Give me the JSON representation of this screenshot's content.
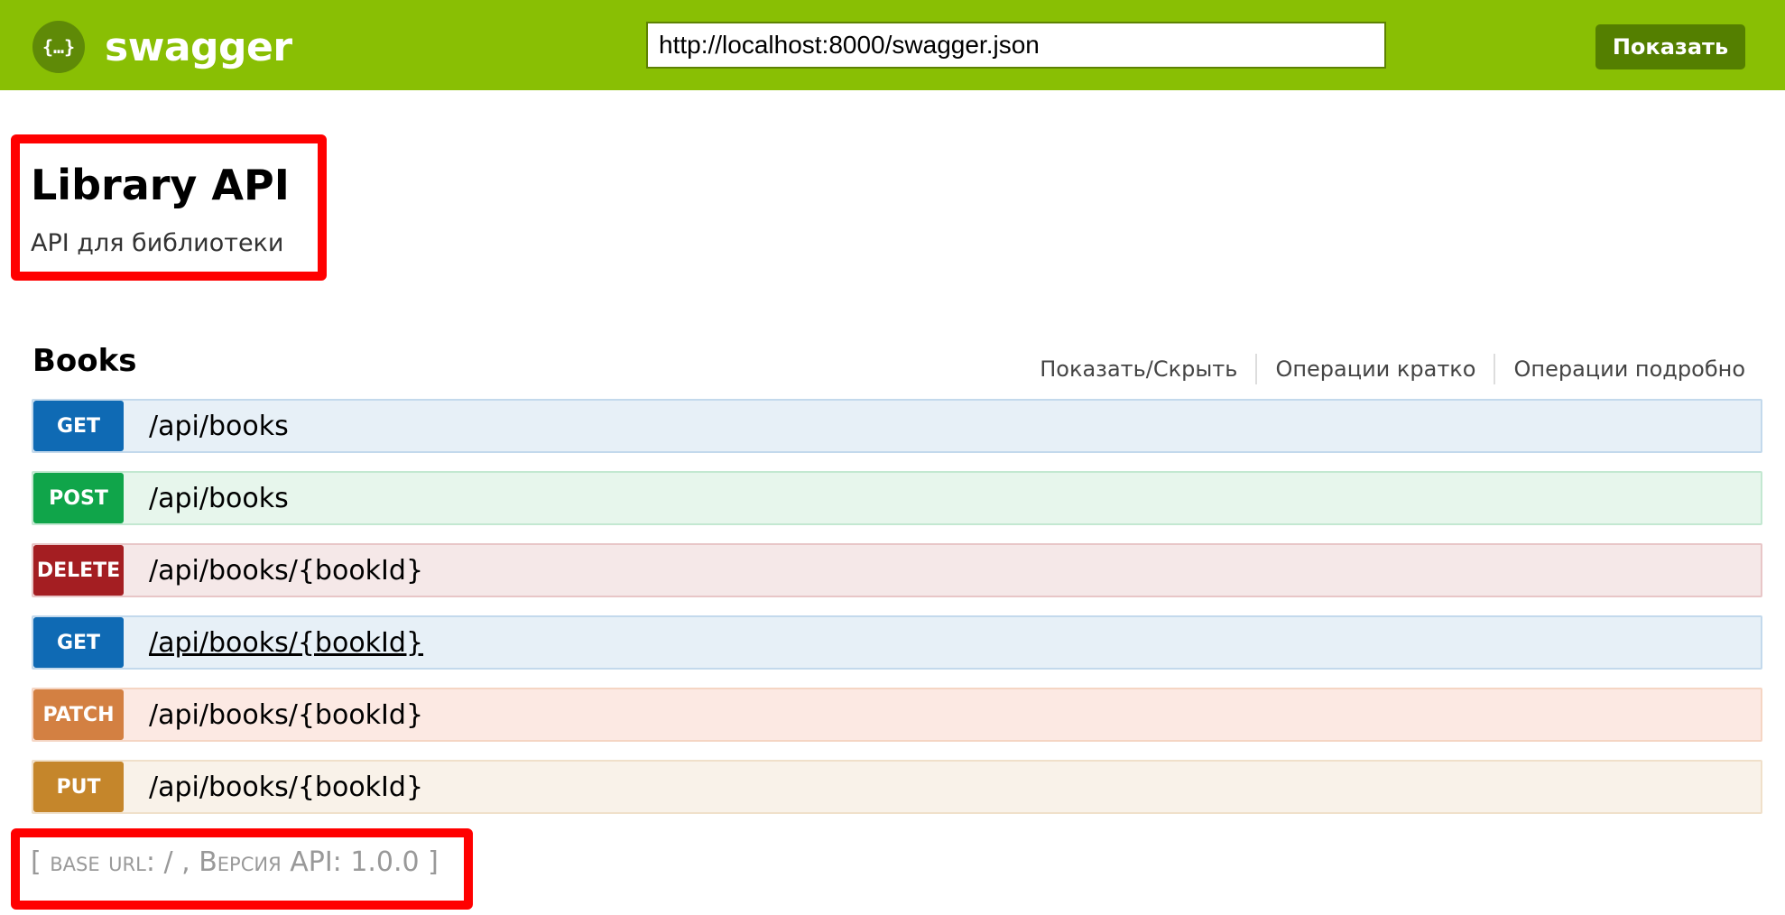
{
  "header": {
    "logo_icon": "swagger-braces-icon",
    "logo_text": "swagger",
    "url_value": "http://localhost:8000/swagger.json",
    "explore_label": "Показать",
    "bg_color": "#89bf04"
  },
  "info": {
    "title": "Library API",
    "description": "API для библиотеки"
  },
  "resource": {
    "name": "Books",
    "links": [
      "Показать/Скрыть",
      "Операции кратко",
      "Операции подробно"
    ]
  },
  "operations": [
    {
      "method": "GET",
      "path": "/api/books"
    },
    {
      "method": "POST",
      "path": "/api/books"
    },
    {
      "method": "DELETE",
      "path": "/api/books/{bookId}"
    },
    {
      "method": "GET",
      "path": "/api/books/{bookId}"
    },
    {
      "method": "PATCH",
      "path": "/api/books/{bookId}"
    },
    {
      "method": "PUT",
      "path": "/api/books/{bookId}"
    }
  ],
  "footer": {
    "open": "[ ",
    "base_url_label": "base url",
    "base_url_sep": ": / , ",
    "version_label": "Версия",
    "version_rest": " API: 1.0.0 ]"
  },
  "colors": {
    "get": "#0f6ab4",
    "post": "#10a54a",
    "delete": "#a41e22",
    "patch": "#d38042",
    "put": "#c5862b",
    "highlight": "#ff0000"
  }
}
